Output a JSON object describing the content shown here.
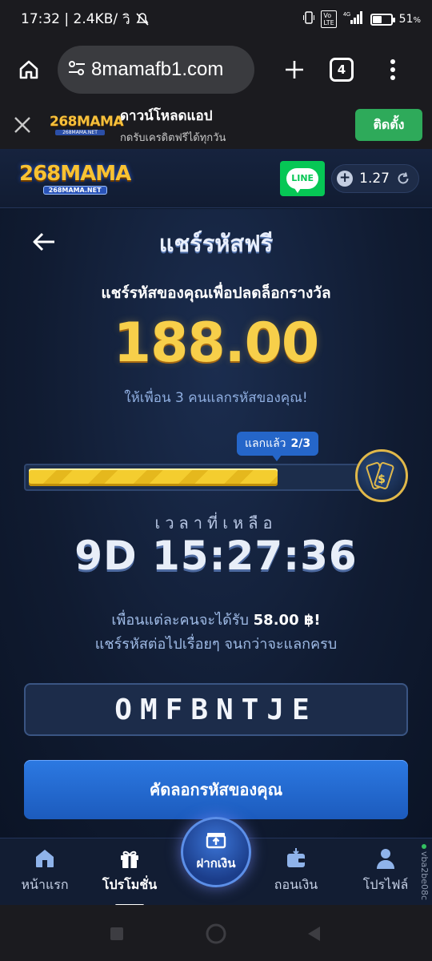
{
  "status": {
    "time_net": "17:32 | 2.4KB/",
    "wifi": "วิ",
    "battery_pct": "51",
    "battery_unit": "%",
    "battery_level": 0.51
  },
  "browser": {
    "url": "8mamafb1.com",
    "tab_count": "4"
  },
  "banner": {
    "logo": "268MAMA",
    "logo_sub": "268MAMA.NET",
    "title": "ดาวน์โหลดแอป",
    "subtitle": "กดรับเครดิตฟรีได้ทุกวัน",
    "install": "ติดตั้ง"
  },
  "header": {
    "logo": "268MAMA",
    "logo_sub": "268MAMA.NET",
    "line": "LINE",
    "balance": "1.27"
  },
  "main": {
    "title": "แชร์รหัสฟรี",
    "subtitle": "แชร์รหัสของคุณเพื่อปลดล็อกรางวัล",
    "amount": "188.00",
    "invite": "ให้เพื่อน 3 คนแลกรหัสของคุณ!",
    "redeemed_label": "แลกแล้ว",
    "redeemed_value": "2/3",
    "progress": 0.74,
    "time_label": "เวลาที่เหลือ",
    "countdown": "9D 15:27:36",
    "info_prefix": "เพื่อนแต่ละคนจะได้รับ",
    "info_amount": "58.00 ฿!",
    "info_line2": "แชร์รหัสต่อไปเรื่อยๆ จนกว่าจะแลกครบ",
    "code": "OMFBNTJE",
    "copy_button": "คัดลอกรหัสของคุณ"
  },
  "nav": {
    "home": "หน้าแรก",
    "promotions": "โปรโมชั่น",
    "deposit": "ฝากเงิน",
    "withdraw": "ถอนเงิน",
    "profile": "โปรไฟล์",
    "side_tag": "vba2be08c"
  }
}
